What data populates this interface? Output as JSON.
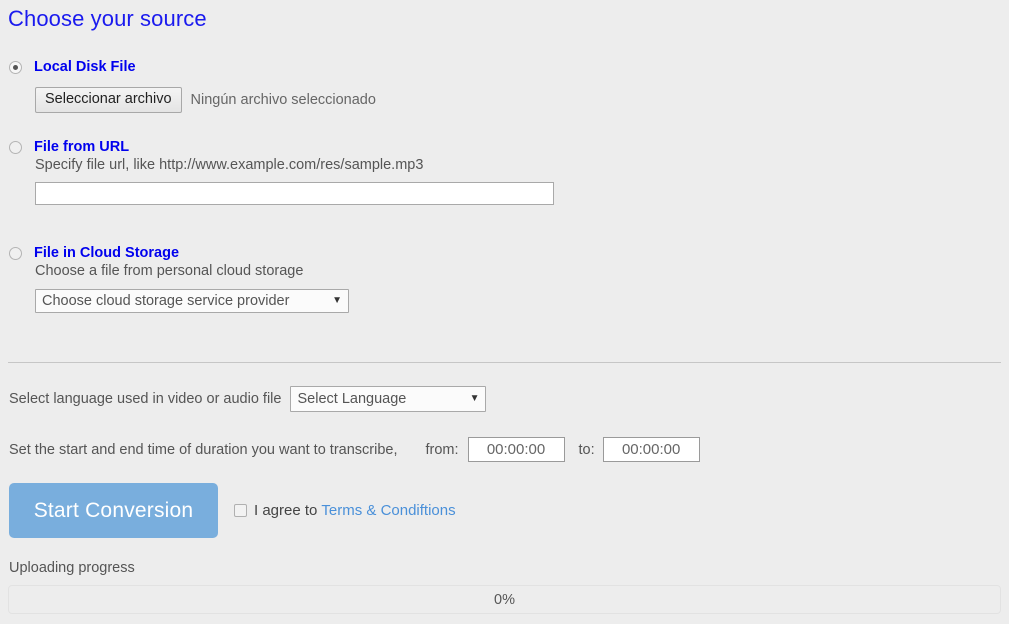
{
  "page": {
    "title": "Choose your source",
    "title_color": "#1a1aee",
    "background_color": "#ededed"
  },
  "sources": {
    "local": {
      "label": "Local Disk File",
      "selected": true,
      "file_button_label": "Seleccionar archivo",
      "file_status": "Ningún archivo seleccionado"
    },
    "url": {
      "label": "File from URL",
      "selected": false,
      "hint": "Specify file url, like http://www.example.com/res/sample.mp3",
      "input_value": "",
      "input_placeholder": ""
    },
    "cloud": {
      "label": "File in Cloud Storage",
      "selected": false,
      "hint": "Choose a file from personal cloud storage",
      "select_value": "Choose cloud storage service provider",
      "caret": "▼"
    }
  },
  "settings": {
    "language_label": "Select language used in video or audio file",
    "language_value": "Select Language",
    "language_caret": "▼",
    "duration_label": "Set the start and end time of duration you want to transcribe,",
    "from_label": "from:",
    "from_value": "00:00:00",
    "to_label": "to:",
    "to_value": "00:00:00"
  },
  "actions": {
    "start_label": "Start Conversion",
    "start_color": "#79aedd",
    "agree_text": "I agree to",
    "terms_label": "Terms & Condiftions",
    "terms_color": "#4a90d9",
    "agree_checked": false
  },
  "progress": {
    "label": "Uploading progress",
    "percent_text": "0%",
    "percent_value": 0
  }
}
